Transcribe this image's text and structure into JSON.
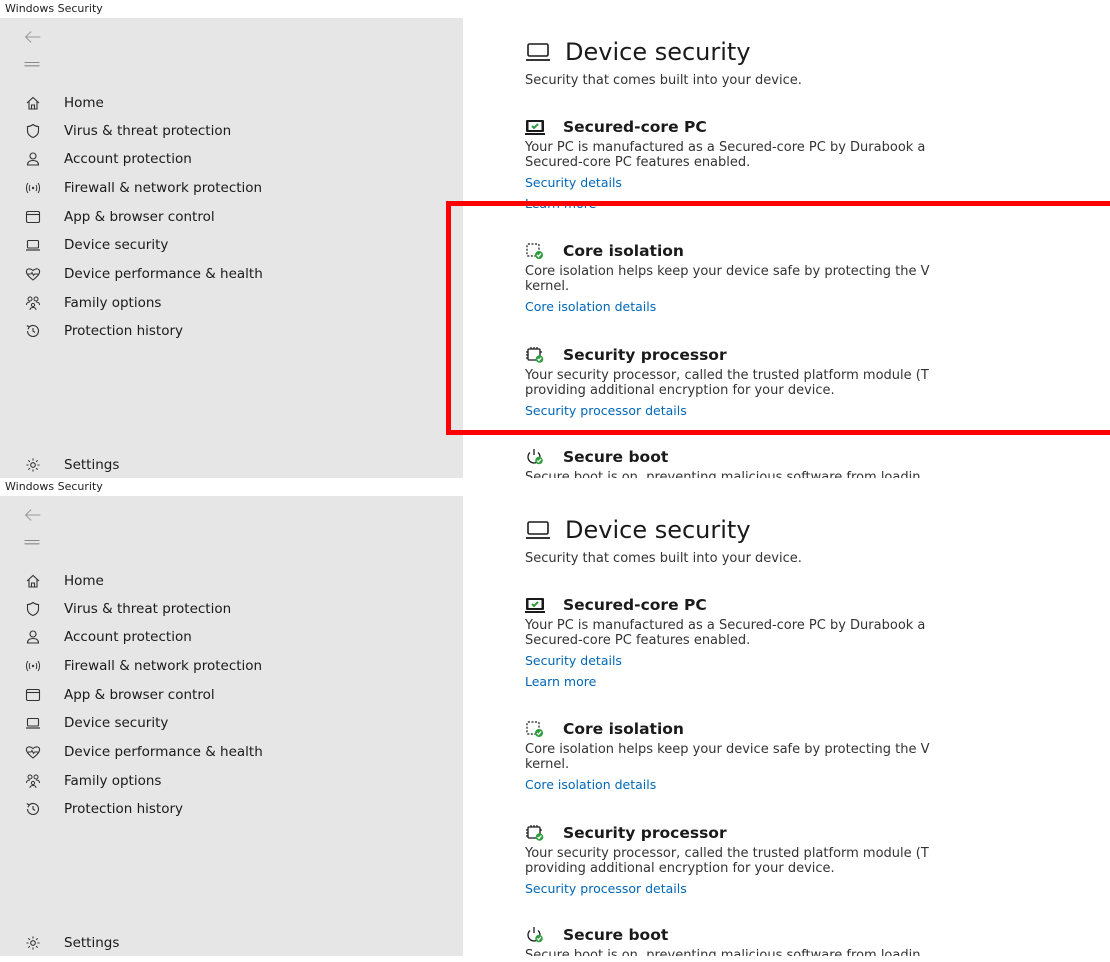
{
  "app_title": "Windows Security",
  "sidebar": {
    "back_icon": "back-arrow-icon",
    "menu_icon": "hamburger-menu-icon",
    "items": [
      {
        "label": "Home",
        "icon": "home-icon"
      },
      {
        "label": "Virus & threat protection",
        "icon": "shield-icon"
      },
      {
        "label": "Account protection",
        "icon": "person-icon"
      },
      {
        "label": "Firewall & network protection",
        "icon": "wifi-antenna-icon"
      },
      {
        "label": "App & browser control",
        "icon": "browser-window-icon"
      },
      {
        "label": "Device security",
        "icon": "laptop-icon"
      },
      {
        "label": "Device performance & health",
        "icon": "heart-pulse-icon"
      },
      {
        "label": "Family options",
        "icon": "family-icon"
      },
      {
        "label": "Protection history",
        "icon": "history-icon"
      }
    ],
    "settings_label": "Settings",
    "settings_icon": "gear-icon"
  },
  "main": {
    "title": "Device security",
    "subtitle": "Security that comes built into your device.",
    "sections": {
      "secured_core": {
        "title": "Secured-core PC",
        "desc_line1": "Your PC is manufactured as a Secured-core PC by Durabook a",
        "desc_line2": "Secured-core PC features enabled.",
        "link1": "Security details",
        "link2": "Learn more"
      },
      "core_isolation": {
        "title": "Core isolation",
        "desc_line1": "Core isolation helps keep your device safe by protecting the V",
        "desc_line2": "kernel.",
        "link1": "Core isolation details"
      },
      "security_processor": {
        "title": "Security processor",
        "desc_line1": "Your security processor, called the trusted platform module (T",
        "desc_line2": "providing additional encryption for your device.",
        "link1": "Security processor details"
      },
      "secure_boot": {
        "title": "Secure boot",
        "desc_line1": "Secure boot is on, preventing malicious software from loadin"
      }
    }
  },
  "colors": {
    "sidebar_bg": "#e6e6e6",
    "link": "#0067b8",
    "highlight": "#ff0000",
    "status_ok": "#2e9e3e"
  }
}
